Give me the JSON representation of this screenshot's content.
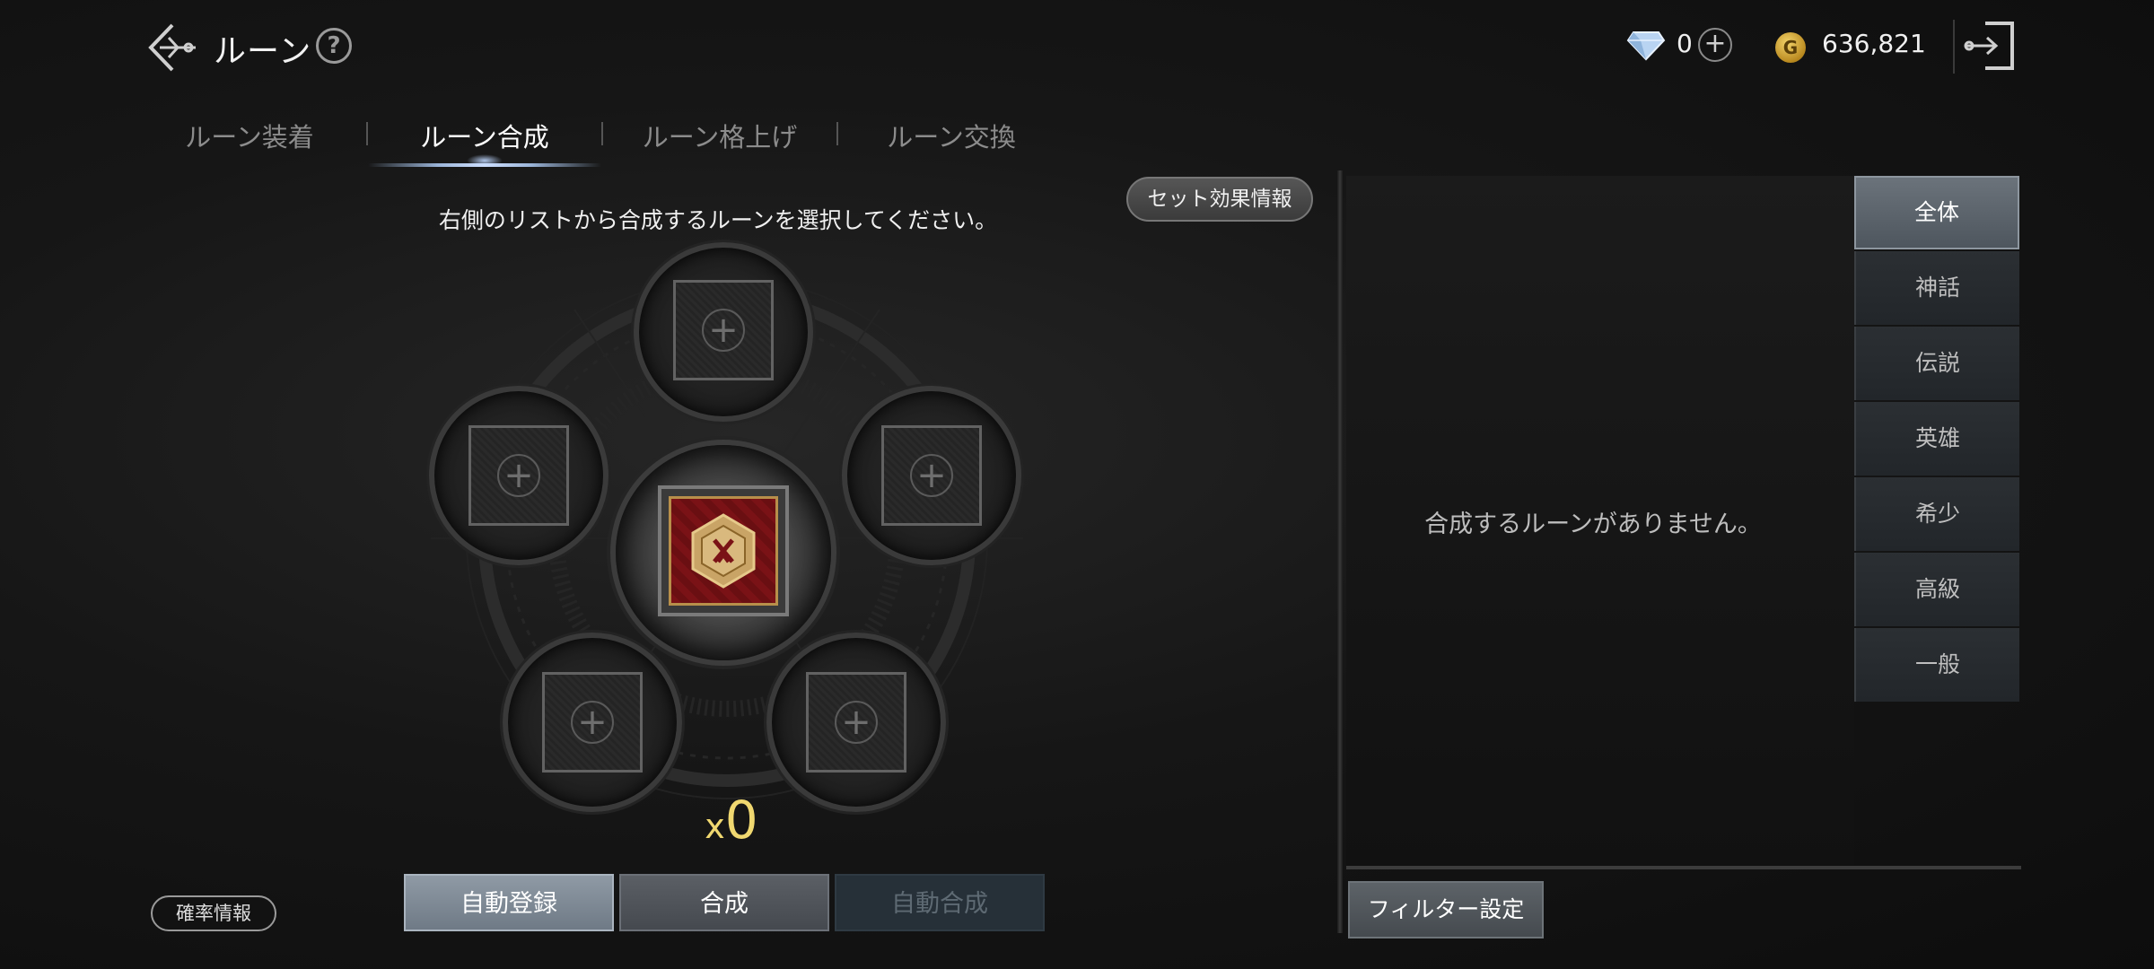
{
  "header": {
    "title": "ルーン",
    "help": "?",
    "gem_count": "0",
    "gold_count": "636,821",
    "gold_symbol": "G"
  },
  "tabs": [
    {
      "label": "ルーン装着",
      "active": false
    },
    {
      "label": "ルーン合成",
      "active": true
    },
    {
      "label": "ルーン格上げ",
      "active": false
    },
    {
      "label": "ルーン交換",
      "active": false
    }
  ],
  "left": {
    "set_effect_button": "セット効果情報",
    "instruction": "右側のリストから合成するルーンを選択してください。",
    "multiplier_x": "x",
    "multiplier_value": "0",
    "probability_button": "確率情報",
    "slot_plus": "+",
    "actions": {
      "auto_register": "自動登録",
      "synthesize": "合成",
      "auto_synthesize": "自動合成"
    }
  },
  "right": {
    "empty_message": "合成するルーンがありません。",
    "filters": [
      {
        "label": "全体",
        "active": true
      },
      {
        "label": "神話",
        "active": false
      },
      {
        "label": "伝説",
        "active": false
      },
      {
        "label": "英雄",
        "active": false
      },
      {
        "label": "希少",
        "active": false
      },
      {
        "label": "高級",
        "active": false
      },
      {
        "label": "一般",
        "active": false
      }
    ],
    "filter_settings_button": "フィルター設定"
  },
  "colors": {
    "accent_gold": "#f0d870",
    "rune_red": "#7a1216",
    "active_filter": "#6b737b"
  }
}
